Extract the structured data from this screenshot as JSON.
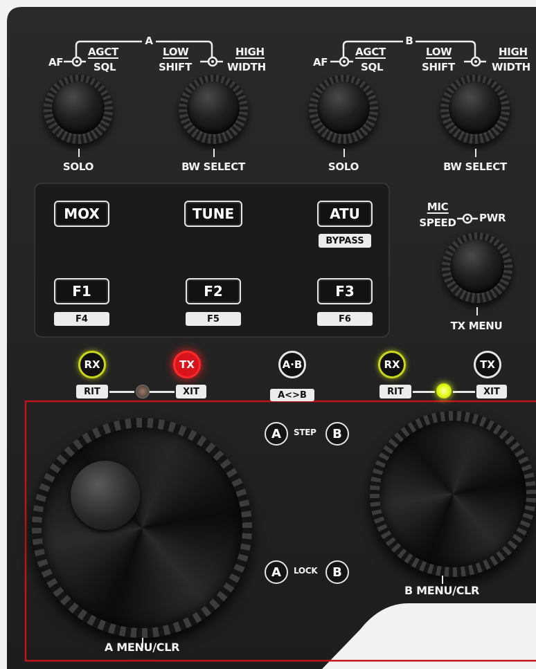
{
  "colors": {
    "panel": "#232323",
    "label": "#f4f4f4",
    "rx_ring": "#c8d61e",
    "tx_ring": "#ff2a2a",
    "led_on": "#e6ff1a",
    "highlight_box": "#c0161b"
  },
  "upper": {
    "group_a": "A",
    "group_b": "B",
    "af": "AF",
    "agct": "AGCT",
    "sql": "SQL",
    "low": "LOW",
    "shift": "SHIFT",
    "high": "HIGH",
    "width": "WIDTH",
    "solo": "SOLO",
    "bw_select": "BW SELECT"
  },
  "keys": {
    "mox": "MOX",
    "tune": "TUNE",
    "atu": "ATU",
    "bypass": "BYPASS",
    "f1": "F1",
    "f2": "F2",
    "f3": "F3",
    "f4": "F4",
    "f5": "F5",
    "f6": "F6"
  },
  "mic": {
    "mic": "MIC",
    "speed": "SPEED",
    "pwr": "PWR",
    "tx_menu": "TX MENU"
  },
  "status": {
    "rx": "RX",
    "tx": "TX",
    "rit": "RIT",
    "xit": "XIT",
    "ab": "A·B",
    "a_swap_b": "A<>B"
  },
  "lower": {
    "a": "A",
    "b": "B",
    "step": "STEP",
    "lock": "LOCK",
    "a_menu_clr": "A MENU/CLR",
    "b_menu_clr": "B MENU/CLR"
  },
  "icons": [
    "knob-connector-icon",
    "led-icon"
  ]
}
